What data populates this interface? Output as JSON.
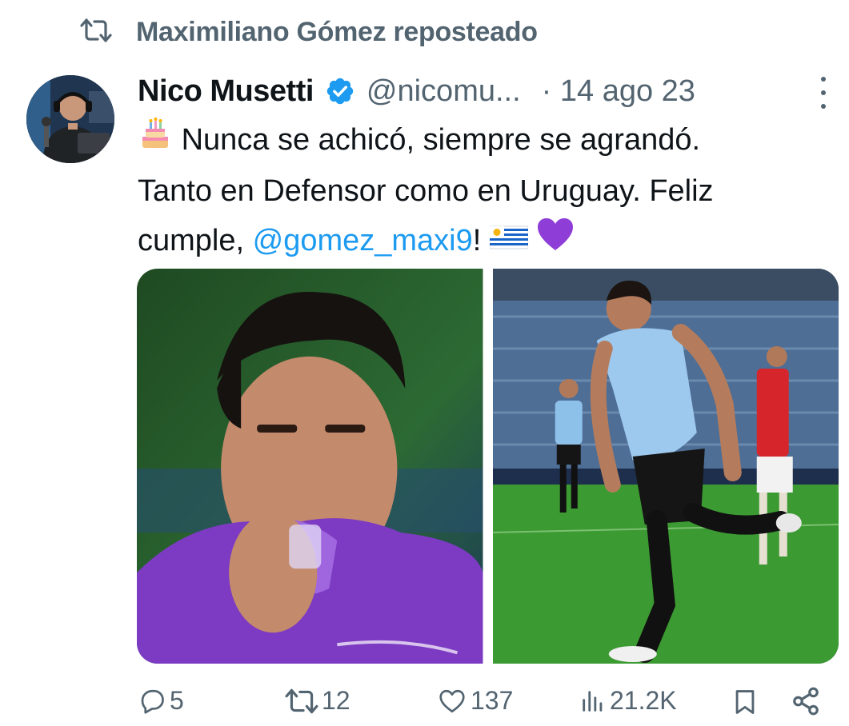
{
  "repost": {
    "icon": "repost-icon",
    "text": "Maximiliano Gómez reposteado"
  },
  "author": {
    "display_name": "Nico Musetti",
    "verified_icon": "verified-badge-icon",
    "handle": "@nicomu...",
    "date": "· 14 ago 23"
  },
  "tweet": {
    "line1": "Nunca se achicó, siempre se agrandó.",
    "line2": "Tanto en Defensor como en Uruguay. Feliz",
    "line3_prefix": "cumple, ",
    "mention": "@gomez_maxi9",
    "line3_suffix": "!",
    "emoji_cake": "birthday-cake-emoji",
    "emoji_flag": "uruguay-flag-emoji",
    "emoji_heart": "purple-heart-emoji"
  },
  "media": {
    "photo1": "player-kissing-purple-jersey-photo",
    "photo2": "player-celebrating-uruguay-18-photo"
  },
  "actions": {
    "replies": "5",
    "reposts": "12",
    "likes": "137",
    "views": "21.2K"
  },
  "colors": {
    "text": "#0f1419",
    "secondary": "#536471",
    "link": "#1d9bf0",
    "verified": "#1d9bf0"
  }
}
